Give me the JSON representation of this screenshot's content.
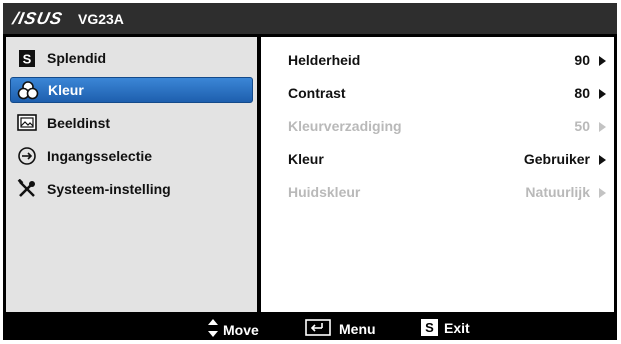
{
  "header": {
    "brand": "/ISUS",
    "model": "VG23A"
  },
  "menu": [
    {
      "name": "splendid",
      "label": "Splendid",
      "icon": "splendid-s-icon"
    },
    {
      "name": "kleur",
      "label": "Kleur",
      "icon": "color-circles-icon",
      "selected": true
    },
    {
      "name": "beeldinst",
      "label": "Beeldinst",
      "icon": "image-icon"
    },
    {
      "name": "ingangsselectie",
      "label": "Ingangsselectie",
      "icon": "input-arrow-icon"
    },
    {
      "name": "systeem",
      "label": "Systeem-instelling",
      "icon": "tools-icon"
    }
  ],
  "settings": [
    {
      "name": "helderheid",
      "label": "Helderheid",
      "value": "90",
      "enabled": true
    },
    {
      "name": "contrast",
      "label": "Contrast",
      "value": "80",
      "enabled": true
    },
    {
      "name": "kleurverzadiging",
      "label": "Kleurverzadiging",
      "value": "50",
      "enabled": false
    },
    {
      "name": "kleur",
      "label": "Kleur",
      "value": "Gebruiker",
      "enabled": true
    },
    {
      "name": "huidskleur",
      "label": "Huidskleur",
      "value": "Natuurlijk",
      "enabled": false
    }
  ],
  "footer": {
    "move": "Move",
    "menu": "Menu",
    "exit_key": "S",
    "exit": "Exit"
  },
  "icons": {
    "splendid_key": "S"
  },
  "colors": {
    "selected": "#2a72c4",
    "left_panel": "#e3e3e3",
    "disabled_text": "#b9b9b9"
  }
}
